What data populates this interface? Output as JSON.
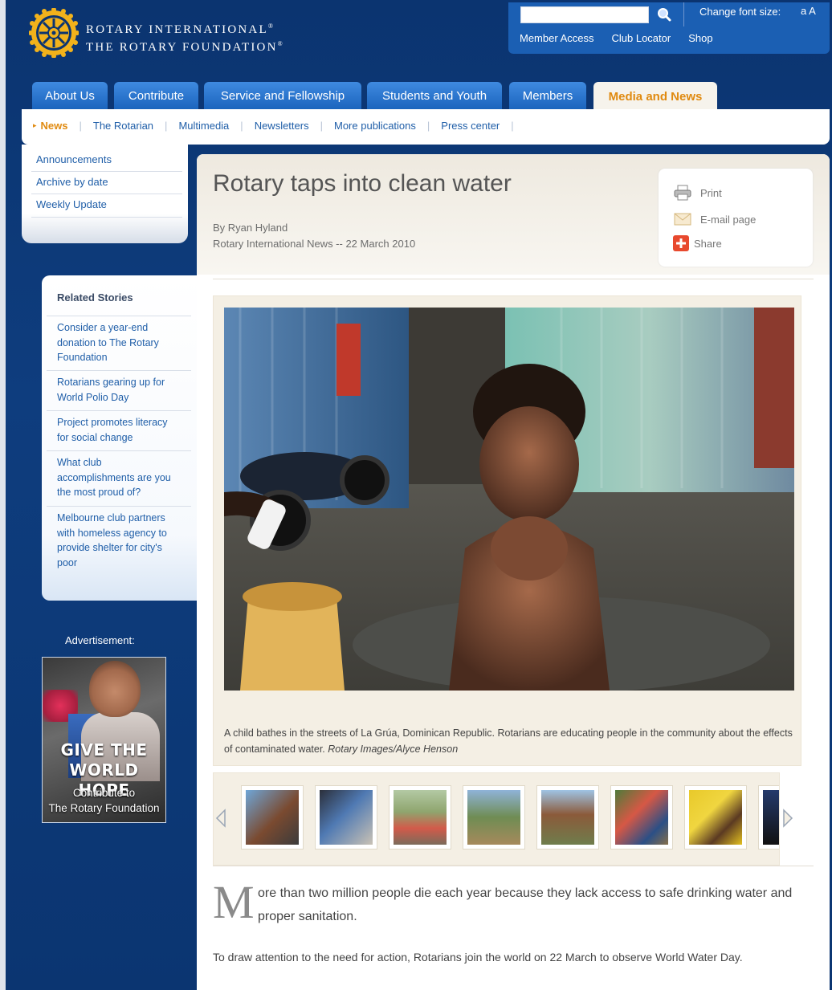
{
  "brand": {
    "line1": "ROTARY INTERNATIONAL",
    "line2": "THE ROTARY FOUNDATION",
    "mark": "®"
  },
  "utility": {
    "search_placeholder": "",
    "font_size_label": "Change font size:",
    "font_size_toggle": "a A",
    "links": [
      "Member Access",
      "Club Locator",
      "Shop"
    ]
  },
  "nav": {
    "tabs": [
      "About Us",
      "Contribute",
      "Service and Fellowship",
      "Students and Youth",
      "Members",
      "Media and News"
    ],
    "active_tab": "Media and News"
  },
  "subnav": {
    "items": [
      "News",
      "The Rotarian",
      "Multimedia",
      "Newsletters",
      "More publications",
      "Press center"
    ]
  },
  "sidebar": {
    "menu": [
      "Announcements",
      "Archive by date",
      "Weekly Update"
    ],
    "related_title": "Related Stories",
    "related": [
      "Consider a year-end donation to The Rotary Foundation",
      "Rotarians gearing up for World Polio Day",
      "Project promotes literacy for social change",
      "What club accomplishments are you the most proud of?",
      "Melbourne club partners with homeless agency to provide shelter for city's poor"
    ],
    "ad_label": "Advertisement:",
    "ad": {
      "headline_1": "GIVE THE",
      "headline_2": "WORLD HOPE",
      "sub_1": "Contribute to",
      "sub_2": "The Rotary Foundation"
    }
  },
  "article": {
    "title": "Rotary taps into clean water",
    "author": "By Ryan Hyland",
    "source": "Rotary International News -- 22 March 2010",
    "tools": {
      "print": "Print",
      "email": "E-mail page",
      "share": "Share"
    },
    "caption": "A child bathes in the streets of La Grúa, Dominican Republic. Rotarians are educating people in the community about the effects of contaminated water.",
    "caption_credit": "Rotary Images/Alyce Henson",
    "dropcap": "M",
    "lead": "ore than two million people die each year because they lack access to safe drinking water and proper sanitation.",
    "paragraph": "To draw attention to the need for action, Rotarians join the world on 22 March to observe World Water Day."
  },
  "colors": {
    "page_bg": "#0f3a75",
    "tab_blue": "#2b76d0",
    "accent_orange": "#e08a10",
    "link_blue": "#1f5ea8"
  },
  "icons": {
    "search": "search-icon",
    "print": "printer-icon",
    "email": "envelope-icon",
    "share": "plus-icon",
    "prev": "chevron-left-icon",
    "next": "chevron-right-icon"
  }
}
